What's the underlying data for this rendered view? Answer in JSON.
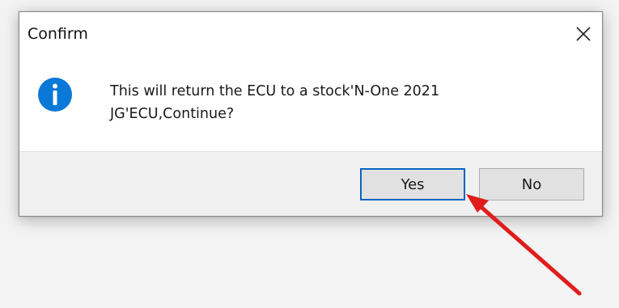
{
  "dialog": {
    "title": "Confirm",
    "message_line1": "This will return the ECU to a stock'N-One 2021",
    "message_line2": "JG'ECU,Continue?",
    "icon": "info-icon",
    "buttons": {
      "yes_label": "Yes",
      "no_label": "No"
    }
  },
  "colors": {
    "info_icon": "#0a78d7",
    "default_button_border": "#0a64c0",
    "annotation_arrow": "#e01c1c"
  }
}
